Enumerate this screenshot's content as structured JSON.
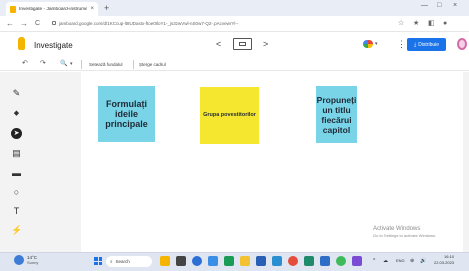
{
  "browser": {
    "tab_title": "Investigate - Jamboard-instrument",
    "tab_close": "×",
    "new_tab": "+",
    "window_controls": [
      "—",
      "□",
      "×"
    ],
    "nav": {
      "back": "←",
      "forward": "→",
      "reload": "C"
    },
    "url": "jamboard.google.com/d/1KCcup-lt8UDastx-ftoe0tloY1-_js3zwVwl-nS0w7-Q2-.pAcvewrYl--",
    "right_icons": [
      "☆",
      "★",
      "◧",
      "●"
    ]
  },
  "app": {
    "title": "Investigate",
    "prev_frame": "<",
    "next_frame": ">",
    "kebab": "⋮",
    "share_label": "Distribuie",
    "share_icon": "⤓"
  },
  "toolbar": {
    "undo": "↶",
    "redo": "↷",
    "zoom": "🔍",
    "zoom_caret": "▾",
    "set_background": "Setează fundalul",
    "clear_frame": "Șterge cadrul"
  },
  "sidetools": [
    {
      "name": "pen-icon",
      "glyph": "✎"
    },
    {
      "name": "eraser-icon",
      "glyph": "◆"
    },
    {
      "name": "select-icon",
      "glyph": "➤"
    },
    {
      "name": "sticky-note-icon",
      "glyph": "▤"
    },
    {
      "name": "image-icon",
      "glyph": "▬"
    },
    {
      "name": "shape-icon",
      "glyph": "○"
    },
    {
      "name": "text-box-icon",
      "glyph": "T"
    },
    {
      "name": "laser-icon",
      "glyph": "⚡"
    }
  ],
  "notes": [
    {
      "text": "Formulați ideile principale",
      "color": "#7ad4e8"
    },
    {
      "text": "Grupa povestitorilor",
      "color": "#f5e630"
    },
    {
      "text": "Propuneți un titlu fiecărui capitol",
      "color": "#7ad4e8"
    }
  ],
  "watermark": {
    "line1": "Activate Windows",
    "line2": "Go to Settings to activate Windows."
  },
  "taskbar": {
    "weather_temp": "14°C",
    "weather_desc": "Sunny",
    "search_label": "Search",
    "tray_items": [
      "^",
      "☁",
      "ENG",
      "⊕",
      "🔊"
    ],
    "time": "16:10",
    "date": "22.03.2023"
  },
  "colors": {
    "accent": "#1a73e8",
    "note_blue": "#7ad4e8",
    "note_yellow": "#f5e630"
  }
}
